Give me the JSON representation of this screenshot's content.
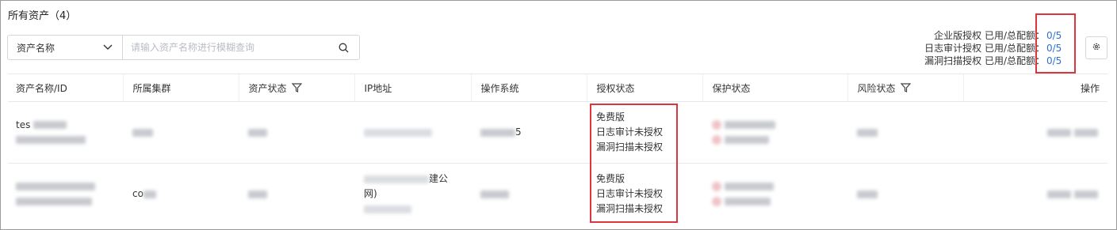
{
  "title": "所有资产（4）",
  "search": {
    "field_label": "资产名称",
    "placeholder": "请输入资产名称进行模糊查询"
  },
  "quota": [
    {
      "label": "企业版授权 已用/总配额：",
      "value": "0/5"
    },
    {
      "label": "日志审计授权 已用/总配额：",
      "value": "0/5"
    },
    {
      "label": "漏洞扫描授权 已用/总配额：",
      "value": "0/5"
    }
  ],
  "columns": [
    "资产名称/ID",
    "所属集群",
    "资产状态",
    "IP地址",
    "操作系统",
    "授权状态",
    "保护状态",
    "风险状态",
    "操作"
  ],
  "rows": [
    {
      "name_line1": "tes",
      "ip_suffix": "",
      "os_suffix": "5",
      "license": [
        "免费版",
        "日志审计未授权",
        "漏洞扫描未授权"
      ]
    },
    {
      "name_line1": "",
      "cluster": "co",
      "ip_text": "建公",
      "ip_line2": "网)",
      "license": [
        "免费版",
        "日志审计未授权",
        "漏洞扫描未授权"
      ]
    }
  ],
  "colors": {
    "accent": "#2f6fd6",
    "highlight": "#d9363e",
    "border": "#d4d7de"
  },
  "icons": [
    "chevron-down-icon",
    "search-icon",
    "settings-icon",
    "filter-icon"
  ]
}
